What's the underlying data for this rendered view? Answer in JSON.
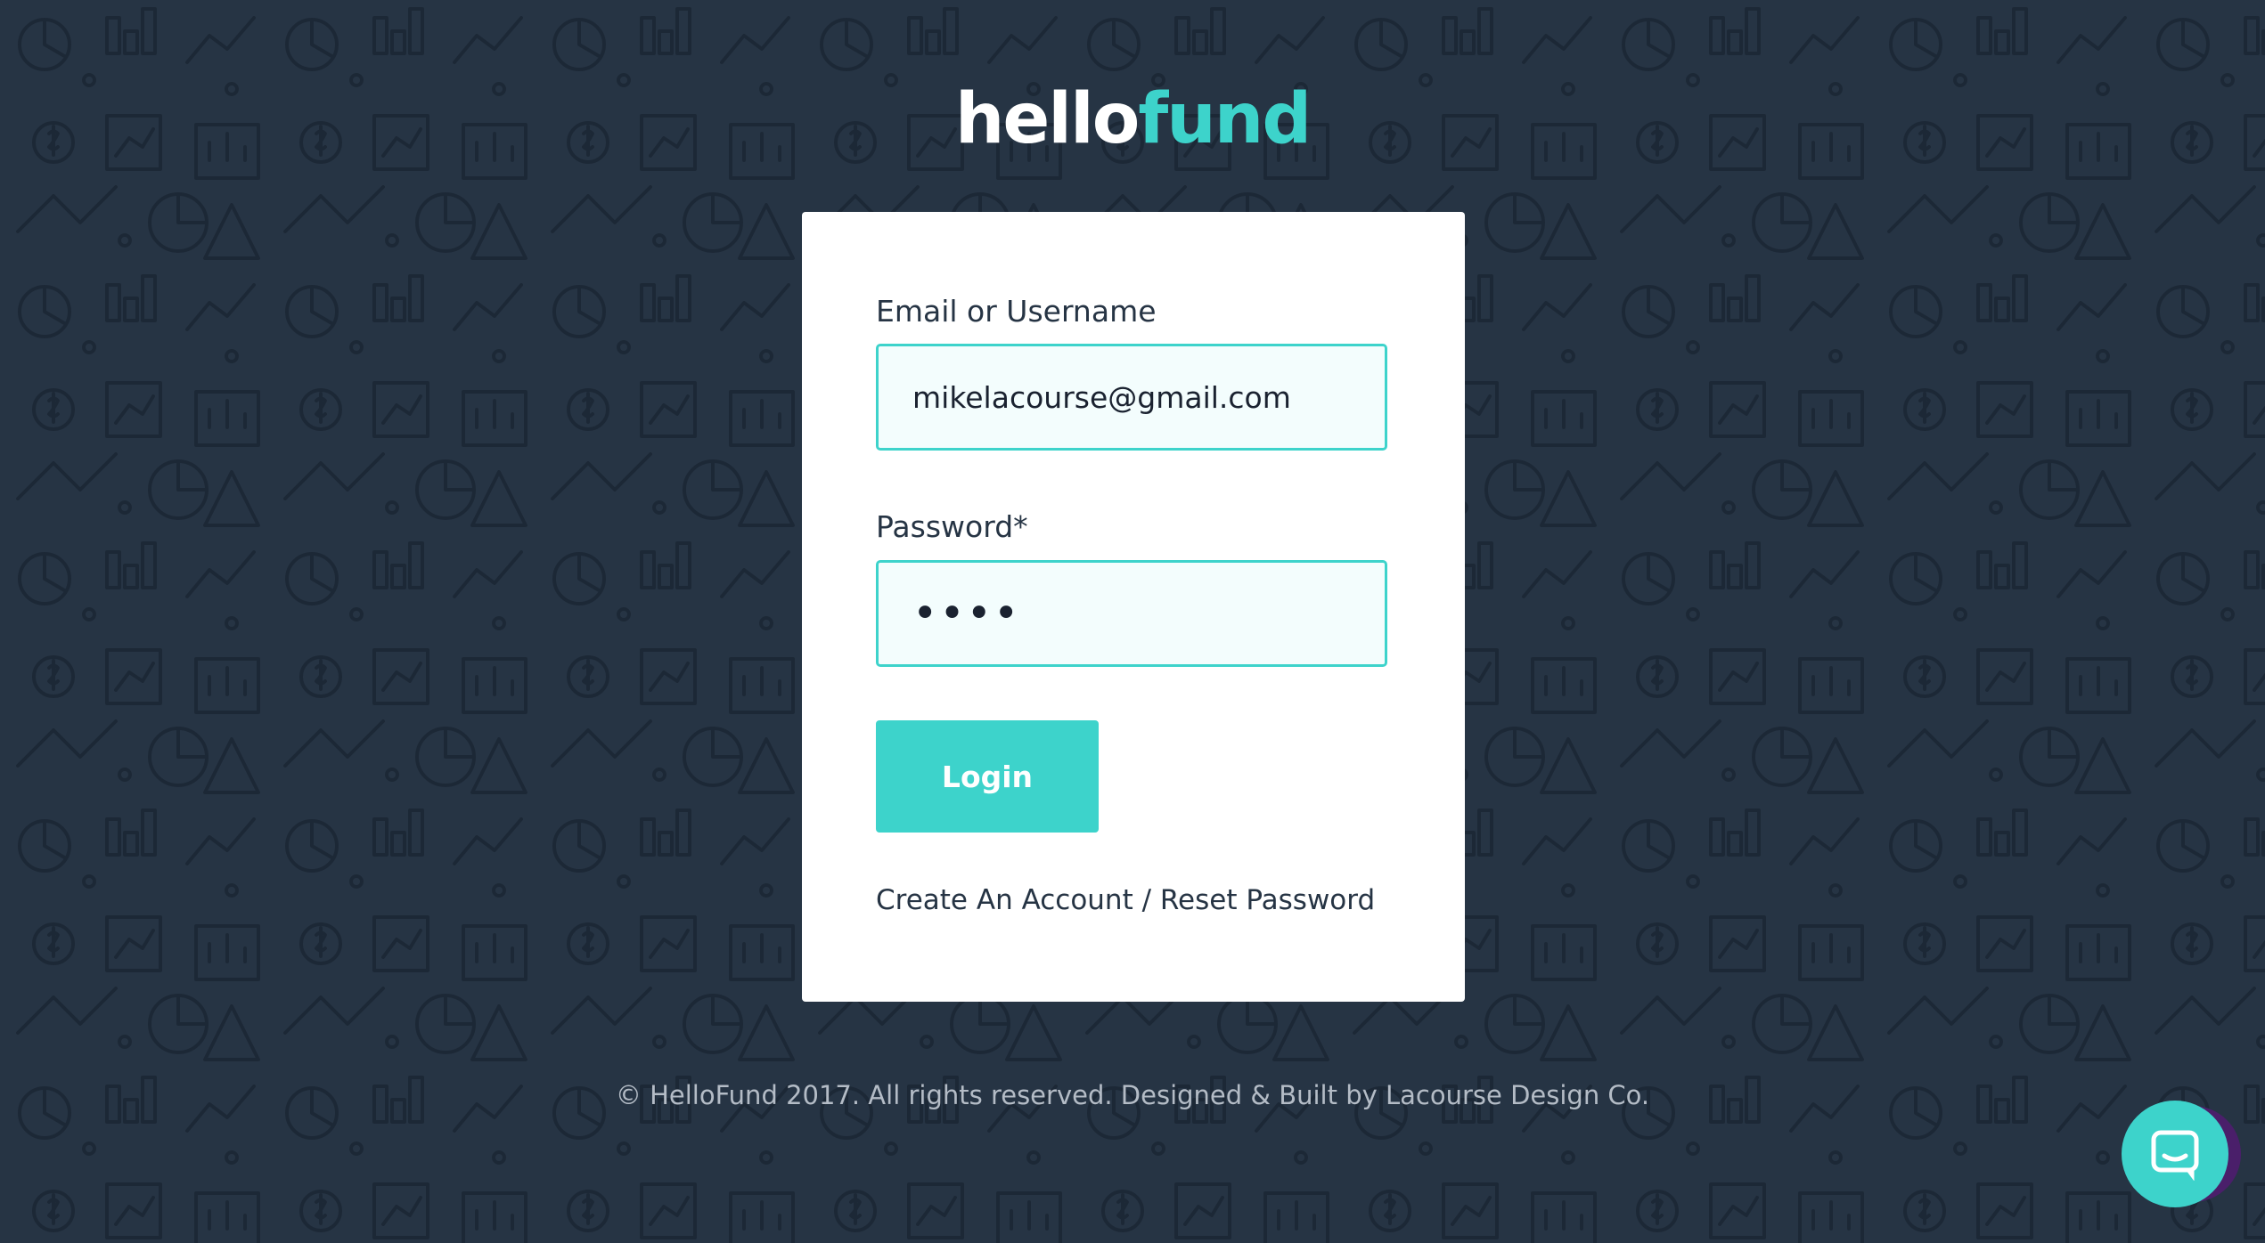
{
  "logo": {
    "part_a": "hello",
    "part_b": "fund"
  },
  "form": {
    "email_label": "Email or Username",
    "email_value": "mikelacourse@gmail.com",
    "password_label": "Password*",
    "password_value": "••••",
    "login_label": "Login",
    "create_account_label": "Create An Account",
    "separator": " / ",
    "reset_password_label": "Reset Password"
  },
  "footer": {
    "text": "© HelloFund 2017. All rights reserved. Designed & Built by Lacourse Design Co."
  },
  "chat": {
    "icon": "chat-icon"
  },
  "colors": {
    "background": "#263444",
    "accent": "#3dd3cb",
    "card": "#ffffff",
    "input_bg": "#f3fdfd",
    "footer_text": "#b4bcc6"
  }
}
